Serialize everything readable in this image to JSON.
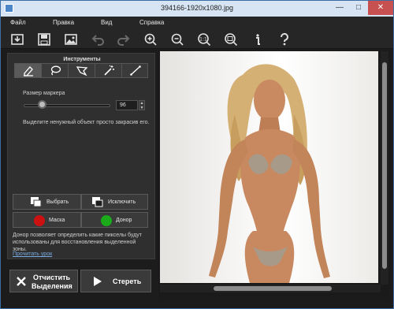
{
  "window": {
    "title": "394166-1920x1080.jpg"
  },
  "menu": {
    "items": [
      "Файл",
      "Правка",
      "Вид",
      "Справка"
    ]
  },
  "toolbar": {
    "buttons": [
      "import-icon",
      "save-icon",
      "image-icon",
      "undo-icon",
      "redo-icon",
      "zoom-in-icon",
      "zoom-out-icon",
      "actual-size-icon",
      "fit-screen-icon",
      "info-icon",
      "help-icon"
    ]
  },
  "panel": {
    "title": "Инструменты",
    "tools": [
      "marker-tool",
      "lasso-tool",
      "polygonal-lasso-tool",
      "magic-wand-tool",
      "line-tool"
    ],
    "active_tool": "marker-tool",
    "marker_size_label": "Размер маркера",
    "marker_size_value": "96",
    "hint": "Выделите ненужный объект просто закрасив его.",
    "select_label": "Выбрать",
    "exclude_label": "Исключить",
    "mask_label": "Маска",
    "donor_label": "Донор",
    "mask_color": "#cc1111",
    "donor_color": "#1aaa1a",
    "donor_desc": "Донор позволяет определить какие пикселы будут использованы для восстановления выделенной зоны.",
    "read_more": "Прочитать урок"
  },
  "actions": {
    "clear_line1": "Отчистить",
    "clear_line2": "Выделения",
    "erase_label": "Стереть"
  },
  "colors": {
    "accent": "#3c6ea6",
    "close_button": "#c75050",
    "link": "#7aaae0"
  }
}
